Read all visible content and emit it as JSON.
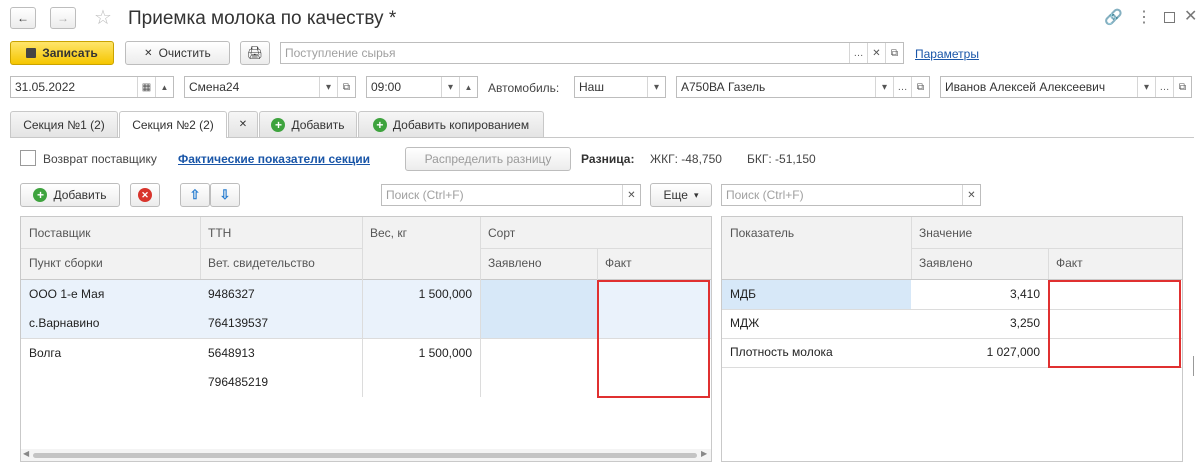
{
  "title": "Приемка молока по качеству *",
  "toolbar": {
    "save": "Записать",
    "clear": "Очистить",
    "source_placeholder": "Поступление сырья",
    "params": "Параметры"
  },
  "header": {
    "date": "31.05.2022",
    "shift": "Смена24",
    "time": "09:00",
    "car_label": "Автомобиль:",
    "car_owner": "Наш",
    "car": "А750ВА Газель",
    "driver": "Иванов Алексей Алексеевич"
  },
  "tabs": [
    {
      "label": "Секция №1 (2)"
    },
    {
      "label": "Секция №2 (2)"
    },
    {
      "label": "Добавить"
    },
    {
      "label": "Добавить копированием"
    }
  ],
  "section": {
    "return_label": "Возврат поставщику",
    "actual_link": "Фактические показатели секции",
    "distribute": "Распределить разницу",
    "diff_label": "Разница:",
    "zhkg": "ЖКГ: -48,750",
    "bkg": "БКГ: -51,150"
  },
  "left_toolbar": {
    "add": "Добавить",
    "search_placeholder": "Поиск (Ctrl+F)",
    "more": "Еще"
  },
  "left_table": {
    "headers": {
      "supplier": "Поставщик",
      "ttn": "ТТН",
      "weight": "Вес, кг",
      "sort": "Сорт",
      "point": "Пункт сборки",
      "vet": "Вет. свидетельство",
      "declared": "Заявлено",
      "fact": "Факт"
    },
    "rows": [
      {
        "supplier": "ООО 1-е Мая",
        "ttn": "9486327",
        "weight": "1 500,000",
        "point": "с.Варнавино",
        "vet": "764139537"
      },
      {
        "supplier": "Волга",
        "ttn": "5648913",
        "weight": "1 500,000",
        "point": "",
        "vet": "796485219"
      }
    ]
  },
  "right_toolbar": {
    "search_placeholder": "Поиск (Ctrl+F)"
  },
  "right_table": {
    "headers": {
      "indicator": "Показатель",
      "value": "Значение",
      "declared": "Заявлено",
      "fact": "Факт"
    },
    "rows": [
      {
        "indicator": "МДБ",
        "declared": "3,410"
      },
      {
        "indicator": "МДЖ",
        "declared": "3,250"
      },
      {
        "indicator": "Плотность молока",
        "declared": "1 027,000"
      }
    ]
  },
  "colors": {
    "highlight": "#e03030",
    "selected_row": "#eaf2fb",
    "selected_cell": "#d7e8f8",
    "primary": "#f5c600"
  }
}
